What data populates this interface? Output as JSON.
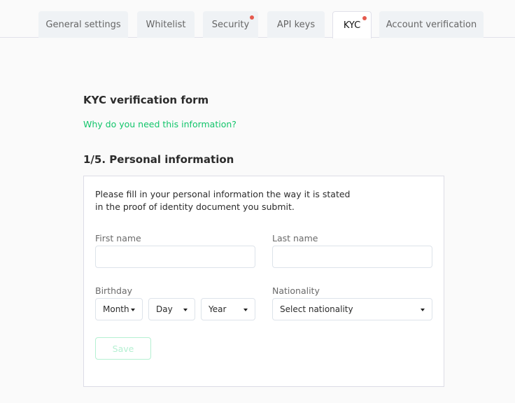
{
  "tabs": [
    {
      "label": "General settings",
      "active": false,
      "notification": false
    },
    {
      "label": "Whitelist",
      "active": false,
      "notification": false
    },
    {
      "label": "Security",
      "active": false,
      "notification": true
    },
    {
      "label": "API keys",
      "active": false,
      "notification": false
    },
    {
      "label": "KYC",
      "active": true,
      "notification": true
    },
    {
      "label": "Account verification",
      "active": false,
      "notification": false
    }
  ],
  "form": {
    "title": "KYC verification form",
    "why_link": "Why do you need this information?",
    "step_title": "1/5. Personal information",
    "intro_line1": "Please fill in your personal information the way it is stated",
    "intro_line2": "in the proof of identity document you submit.",
    "first_name": {
      "label": "First name",
      "value": "",
      "placeholder": ""
    },
    "last_name": {
      "label": "Last name",
      "value": "",
      "placeholder": ""
    },
    "birthday": {
      "label": "Birthday",
      "month": "Month",
      "day": "Day",
      "year": "Year"
    },
    "nationality": {
      "label": "Nationality",
      "value": "Select nationality"
    },
    "save_label": "Save"
  },
  "colors": {
    "accent": "#12c56b",
    "notification_dot": "#e55a4e",
    "disabled_button": "#b5f0d2"
  }
}
